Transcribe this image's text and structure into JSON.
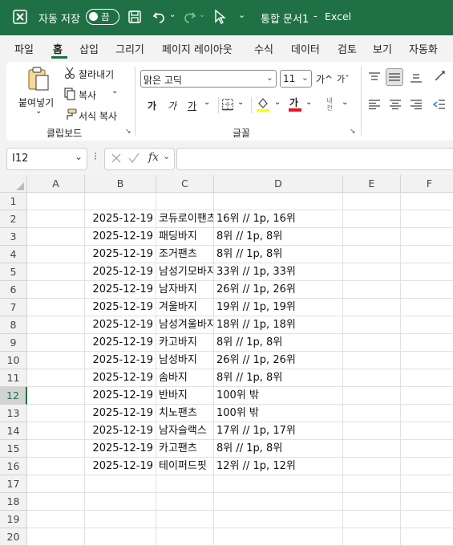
{
  "titlebar": {
    "autosave_label": "자동 저장",
    "autosave_state": "끔",
    "document_title": "통합 문서1",
    "separator": "-",
    "app_name": "Excel"
  },
  "tabs": [
    "파일",
    "홈",
    "삽입",
    "그리기",
    "페이지 레이아웃",
    "수식",
    "데이터",
    "검토",
    "보기",
    "자동화"
  ],
  "ribbon": {
    "paste_label": "붙여넣기",
    "cut_label": "잘라내기",
    "copy_label": "복사",
    "format_painter_label": "서식 복사",
    "clipboard_group": "클립보드",
    "font_name": "맑은 고딕",
    "font_size": "11",
    "grow_label": "가^",
    "shrink_label": "가ˇ",
    "bold_label": "가",
    "italic_label": "가",
    "underline_label": "가",
    "font_color_label": "가",
    "phonetic_label": "내천",
    "font_group": "글꼴"
  },
  "formula_bar": {
    "name_box": "I12",
    "fx_label": "fx",
    "formula": ""
  },
  "sheet": {
    "columns": [
      "A",
      "B",
      "C",
      "D",
      "E",
      "F"
    ],
    "rows": [
      {
        "n": "1",
        "b": "",
        "c": "",
        "d": ""
      },
      {
        "n": "2",
        "b": "2025-12-19",
        "c": "코듀로이팬츠",
        "d": "16위 // 1p, 16위"
      },
      {
        "n": "3",
        "b": "2025-12-19",
        "c": "패딩바지",
        "d": "8위 // 1p, 8위"
      },
      {
        "n": "4",
        "b": "2025-12-19",
        "c": "조거팬츠",
        "d": "8위 // 1p, 8위"
      },
      {
        "n": "5",
        "b": "2025-12-19",
        "c": "남성기모바지",
        "d": "33위 // 1p, 33위"
      },
      {
        "n": "6",
        "b": "2025-12-19",
        "c": "남자바지",
        "d": "26위 // 1p, 26위"
      },
      {
        "n": "7",
        "b": "2025-12-19",
        "c": "겨울바지",
        "d": "19위 // 1p, 19위"
      },
      {
        "n": "8",
        "b": "2025-12-19",
        "c": "남성겨울바지",
        "d": "18위 // 1p, 18위"
      },
      {
        "n": "9",
        "b": "2025-12-19",
        "c": "카고바지",
        "d": "8위 // 1p, 8위"
      },
      {
        "n": "10",
        "b": "2025-12-19",
        "c": "남성바지",
        "d": "26위 // 1p, 26위"
      },
      {
        "n": "11",
        "b": "2025-12-19",
        "c": "솜바지",
        "d": "8위 // 1p, 8위"
      },
      {
        "n": "12",
        "b": "2025-12-19",
        "c": "반바지",
        "d": "100위 밖"
      },
      {
        "n": "13",
        "b": "2025-12-19",
        "c": "치노팬츠",
        "d": "100위 밖"
      },
      {
        "n": "14",
        "b": "2025-12-19",
        "c": "남자슬랙스",
        "d": "17위 // 1p, 17위"
      },
      {
        "n": "15",
        "b": "2025-12-19",
        "c": "카고팬츠",
        "d": "8위 // 1p, 8위"
      },
      {
        "n": "16",
        "b": "2025-12-19",
        "c": "테이퍼드핏",
        "d": "12위 // 1p, 12위"
      },
      {
        "n": "17",
        "b": "",
        "c": "",
        "d": ""
      },
      {
        "n": "18",
        "b": "",
        "c": "",
        "d": ""
      },
      {
        "n": "19",
        "b": "",
        "c": "",
        "d": ""
      },
      {
        "n": "20",
        "b": "",
        "c": "",
        "d": ""
      }
    ]
  },
  "colors": {
    "accent": "#1f7145",
    "font_color_bar": "#e81123",
    "highlight_bar": "#ffff00"
  }
}
